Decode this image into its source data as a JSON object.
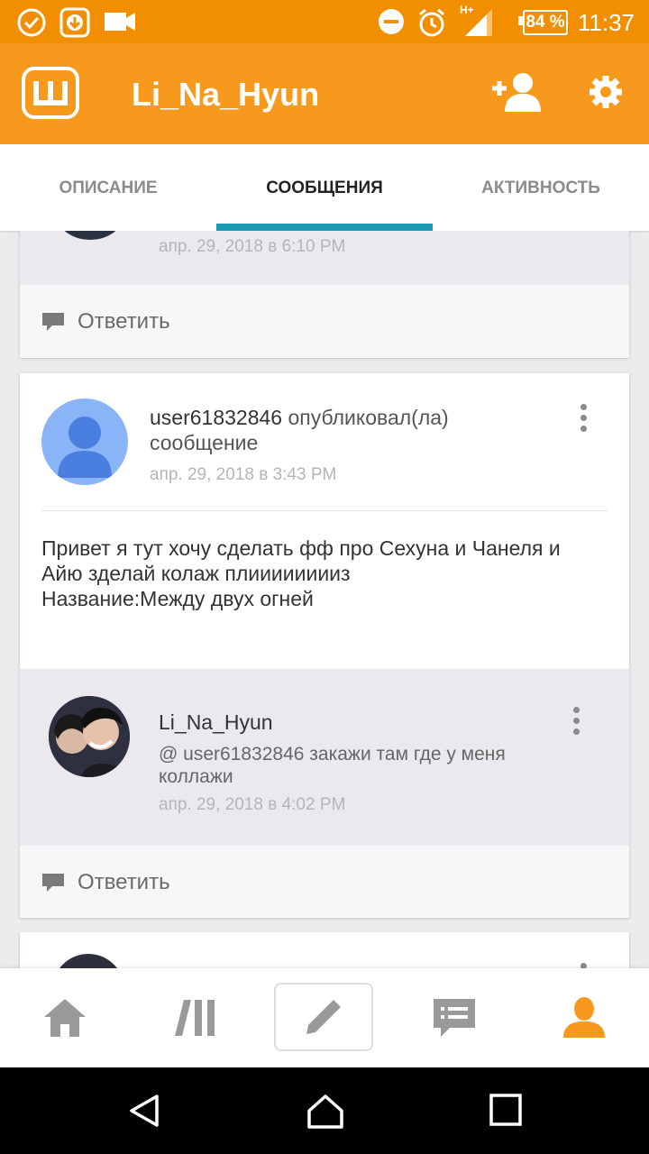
{
  "status_bar": {
    "time": "11:37",
    "battery": "84 %",
    "network": "H+"
  },
  "app_bar": {
    "title": "Li_Na_Hyun"
  },
  "tabs": [
    {
      "label": "ОПИСАНИЕ",
      "active": false
    },
    {
      "label": "СООБЩЕНИЯ",
      "active": true
    },
    {
      "label": "АКТИВНОСТЬ",
      "active": false
    }
  ],
  "accent_color": "#1a9bb0",
  "brand_color": "#f7991d",
  "feed": {
    "partial_card": {
      "date": "апр. 29, 2018 в 6:10 PM",
      "reply_label": "Ответить"
    },
    "post": {
      "username": "user61832846",
      "action": "опубликовал(ла)",
      "action_line2": "сообщение",
      "date": "апр. 29, 2018 в 3:43 PM",
      "text_line1": "Привет я тут хочу сделать фф про Сехуна и Чанеля и",
      "text_line2": "Айю зделай колаж плииииииииз",
      "text_line3": "Название:Между двух огней",
      "reply": {
        "username": "Li_Na_Hyun",
        "text_line1": "@ user61832846  закажи там где у меня",
        "text_line2": "коллажи",
        "date": "апр. 29, 2018 в 4:02 PM"
      },
      "reply_label": "Ответить"
    }
  }
}
